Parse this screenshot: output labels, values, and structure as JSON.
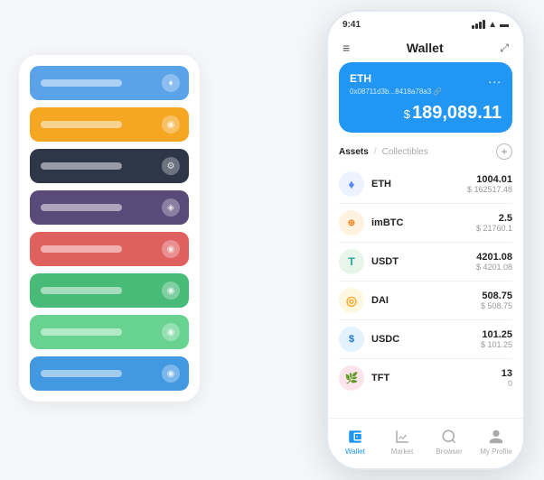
{
  "scene": {
    "card_stack": {
      "items": [
        {
          "color": "card-blue",
          "icon": "♦"
        },
        {
          "color": "card-yellow",
          "icon": "◉"
        },
        {
          "color": "card-dark",
          "icon": "⚙"
        },
        {
          "color": "card-purple",
          "icon": "◈"
        },
        {
          "color": "card-red",
          "icon": "◉"
        },
        {
          "color": "card-green",
          "icon": "◉"
        },
        {
          "color": "card-light-green",
          "icon": "◉"
        },
        {
          "color": "card-bright-blue",
          "icon": "◉"
        }
      ]
    }
  },
  "phone": {
    "status_bar": {
      "time": "9:41",
      "signal": "●●●●",
      "wifi": "WiFi",
      "battery": "🔋"
    },
    "header": {
      "menu_icon": "≡",
      "title": "Wallet",
      "expand_icon": "⤢"
    },
    "eth_card": {
      "label": "ETH",
      "more": "...",
      "address": "0x08711d3b...8418a78a3 🔗",
      "balance_prefix": "$",
      "balance": "189,089.11"
    },
    "assets_section": {
      "tab_active": "Assets",
      "divider": "/",
      "tab_inactive": "Collectibles",
      "add_icon": "+"
    },
    "assets": [
      {
        "name": "ETH",
        "logo_char": "♦",
        "logo_class": "eth-logo",
        "amount": "1004.01",
        "usd": "$ 162517.48"
      },
      {
        "name": "imBTC",
        "logo_char": "⊕",
        "logo_class": "imbtc-logo",
        "amount": "2.5",
        "usd": "$ 21760.1"
      },
      {
        "name": "USDT",
        "logo_char": "T",
        "logo_class": "usdt-logo",
        "amount": "4201.08",
        "usd": "$ 4201.08"
      },
      {
        "name": "DAI",
        "logo_char": "◎",
        "logo_class": "dai-logo",
        "amount": "508.75",
        "usd": "$ 508.75"
      },
      {
        "name": "USDC",
        "logo_char": "$",
        "logo_class": "usdc-logo",
        "amount": "101.25",
        "usd": "$ 101.25"
      },
      {
        "name": "TFT",
        "logo_char": "🌿",
        "logo_class": "tft-logo",
        "amount": "13",
        "usd": "0"
      }
    ],
    "nav": [
      {
        "label": "Wallet",
        "icon": "◎",
        "active": true
      },
      {
        "label": "Market",
        "icon": "📊",
        "active": false
      },
      {
        "label": "Browser",
        "icon": "🌐",
        "active": false
      },
      {
        "label": "My Profile",
        "icon": "👤",
        "active": false
      }
    ]
  }
}
